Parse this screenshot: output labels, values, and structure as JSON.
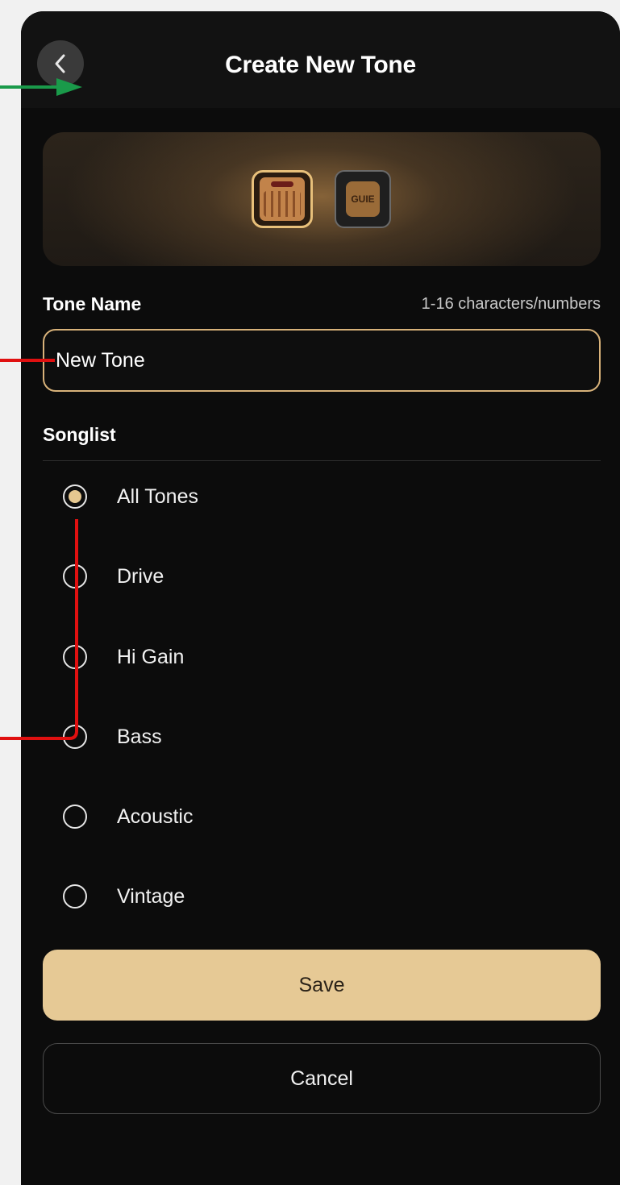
{
  "header": {
    "title": "Create New Tone",
    "back_icon": "chevron-left-icon"
  },
  "banner": {
    "items": [
      {
        "icon": "amp-icon",
        "selected": true
      },
      {
        "icon": "mini-amp-icon",
        "label": "GUIE",
        "selected": false
      }
    ]
  },
  "tone_name": {
    "label": "Tone Name",
    "hint": "1-16 characters/numbers",
    "value": "New Tone"
  },
  "songlist": {
    "label": "Songlist",
    "options": [
      {
        "label": "All Tones",
        "selected": true
      },
      {
        "label": "Drive",
        "selected": false
      },
      {
        "label": "Hi Gain",
        "selected": false
      },
      {
        "label": "Bass",
        "selected": false
      },
      {
        "label": "Acoustic",
        "selected": false
      },
      {
        "label": "Vintage",
        "selected": false
      }
    ]
  },
  "actions": {
    "save_label": "Save",
    "cancel_label": "Cancel"
  },
  "colors": {
    "accent": "#e6c995",
    "background": "#0c0c0c",
    "annotation_green": "#1a9a4a",
    "annotation_red": "#e01010"
  }
}
